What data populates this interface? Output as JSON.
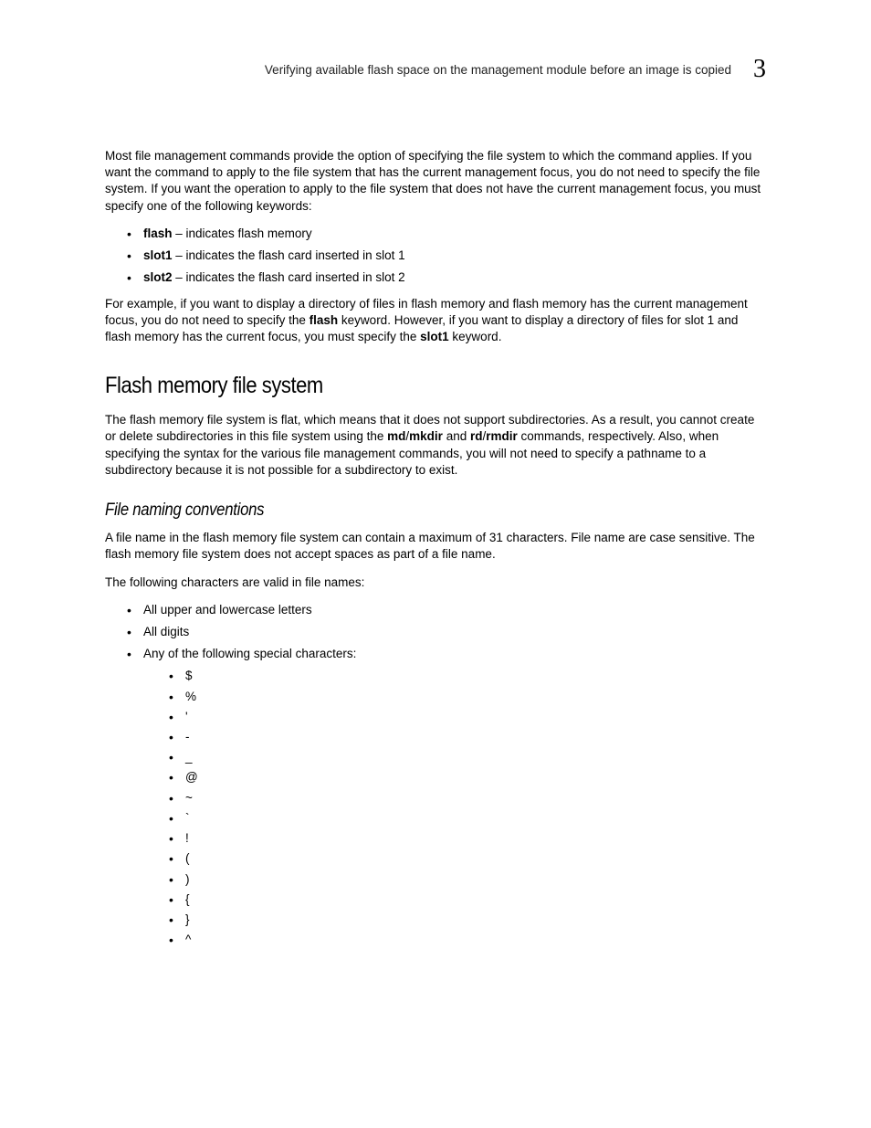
{
  "header": {
    "running": "Verifying available flash space on the management  module before an image is copied",
    "chapter": "3"
  },
  "p1a": "Most file management commands provide the option of specifying the file system to which the command applies. If you want the command to apply to the file system that has the current management focus, you do not need to specify the file system. If you want the operation to apply to the file system that does not have the current management focus, you must specify one of the following keywords:",
  "kw": {
    "flash": "flash",
    "flash_desc": " – indicates flash memory",
    "slot1": "slot1",
    "slot1_desc": " – indicates the flash card inserted in slot 1",
    "slot2": "slot2",
    "slot2_desc": " – indicates the flash card inserted in slot 2"
  },
  "p2": {
    "a": "For example, if you want to display a directory of files in flash memory and flash memory has the current management focus, you do not need to specify the ",
    "b": "flash",
    "c": " keyword. However, if you want to display a directory of files for slot 1 and flash memory has the current focus, you must specify the ",
    "d": "slot1",
    "e": " keyword."
  },
  "h2_flash": "Flash memory file system",
  "p3": {
    "a": "The flash memory file system is flat, which means that it does not support subdirectories. As a result, you cannot create or delete subdirectories in this file system using the ",
    "b": "md",
    "slash1": "/",
    "c": "mkdir",
    "d": " and ",
    "e": "rd",
    "slash2": "/",
    "f": "rmdir",
    "g": " commands, respectively. Also, when specifying the syntax for the various file management commands, you will not need to specify a pathname to a subdirectory because it is not possible for a subdirectory to exist."
  },
  "h3_naming": "File naming conventions",
  "p4": "A file name in the flash memory file system can contain a maximum of 31 characters. File name are case sensitive. The flash memory file system does not accept spaces as part of a file name.",
  "p5": "The following characters are valid in file names:",
  "valid": {
    "l1": "All upper and lowercase letters",
    "l2": "All digits",
    "l3": "Any of the following special characters:",
    "chars": [
      "$",
      "%",
      "'",
      "-",
      "_",
      "@",
      "~",
      "`",
      "!",
      "(",
      ")",
      "{",
      "}",
      "^"
    ]
  }
}
